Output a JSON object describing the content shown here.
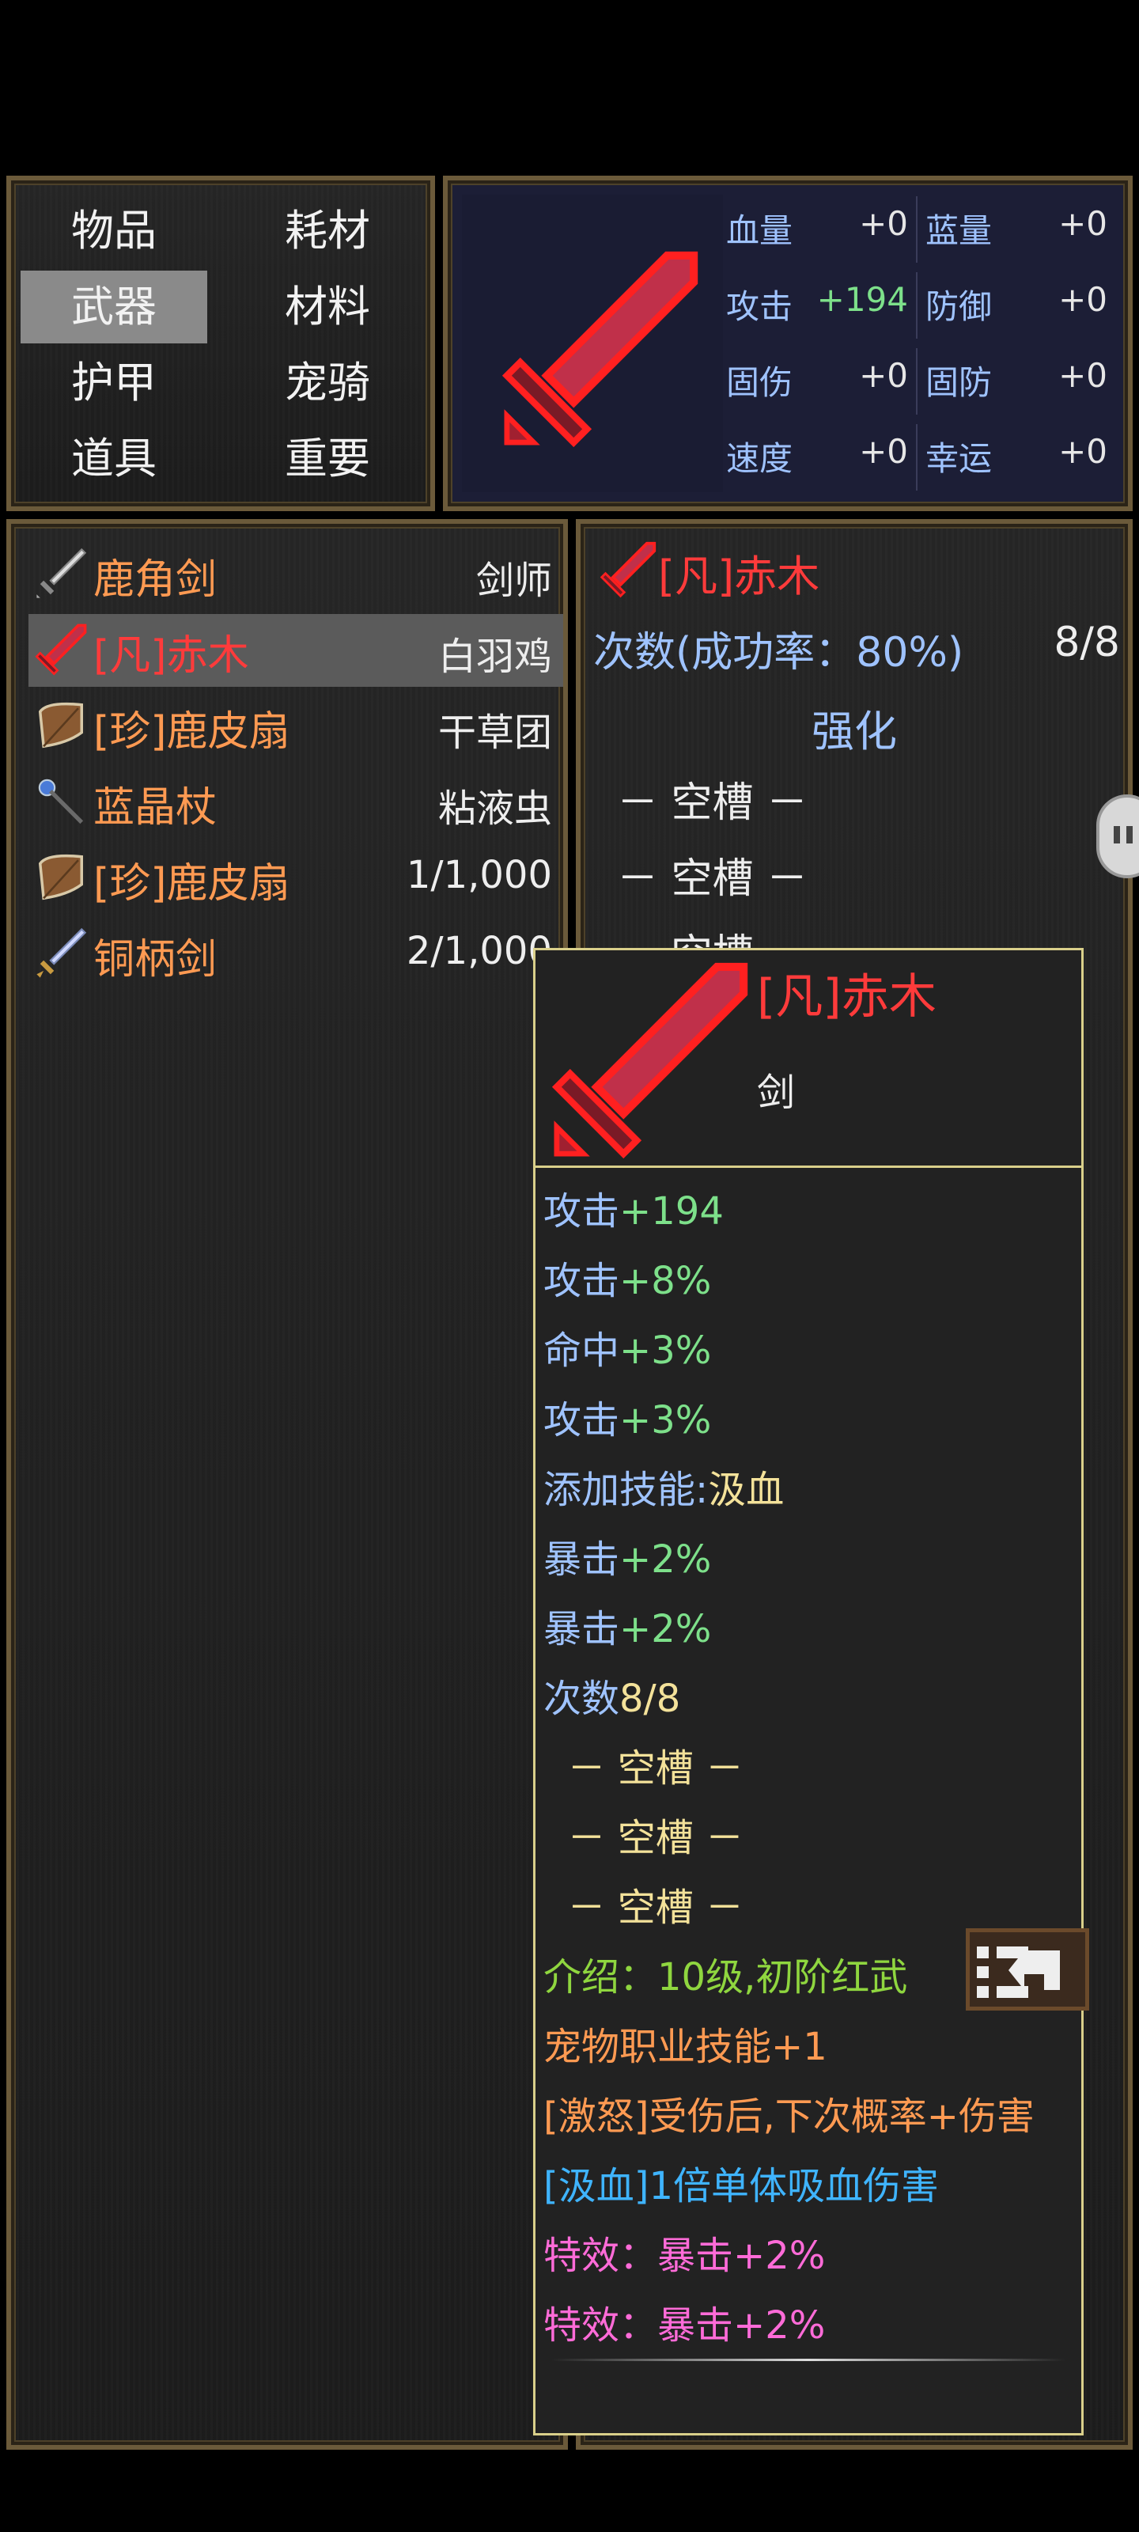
{
  "categories": [
    {
      "label": "物品",
      "selected": false
    },
    {
      "label": "耗材",
      "selected": false
    },
    {
      "label": "武器",
      "selected": true
    },
    {
      "label": "材料",
      "selected": false
    },
    {
      "label": "护甲",
      "selected": false
    },
    {
      "label": "宠骑",
      "selected": false
    },
    {
      "label": "道具",
      "selected": false
    },
    {
      "label": "重要",
      "selected": false
    }
  ],
  "stats": [
    {
      "label": "血量",
      "value": "+0"
    },
    {
      "label": "蓝量",
      "value": "+0"
    },
    {
      "label": "攻击",
      "value": "+194",
      "highlight": true
    },
    {
      "label": "防御",
      "value": "+0"
    },
    {
      "label": "固伤",
      "value": "+0"
    },
    {
      "label": "固防",
      "value": "+0"
    },
    {
      "label": "速度",
      "value": "+0"
    },
    {
      "label": "幸运",
      "value": "+0"
    }
  ],
  "items": [
    {
      "name": "鹿角剑",
      "right": "剑师",
      "icon": "short-sword-icon",
      "color": "#ff9a52",
      "selected": false
    },
    {
      "name": "[凡]赤木",
      "right": "白羽鸡",
      "icon": "red-sword-icon",
      "color": "#ff3b3b",
      "selected": true
    },
    {
      "name": "[珍]鹿皮扇",
      "right": "干草团",
      "icon": "leather-fan-icon",
      "color": "#ff9a52",
      "selected": false
    },
    {
      "name": "蓝晶杖",
      "right": "粘液虫",
      "icon": "crystal-staff-icon",
      "color": "#ff9a52",
      "selected": false
    },
    {
      "name": "[珍]鹿皮扇",
      "right": "1/1,000",
      "icon": "leather-fan-icon",
      "color": "#ff9a52",
      "selected": false
    },
    {
      "name": "铜柄剑",
      "right": "2/1,000",
      "icon": "bronze-sword-icon",
      "color": "#ff9a52",
      "selected": false
    }
  ],
  "detail": {
    "name": "[凡]赤木",
    "attempts_label": "次数(成功率：80%)",
    "attempts_value": "8/8",
    "enhance_label": "强化",
    "slots": [
      "－ 空槽 －",
      "－ 空槽 －",
      "－ 空槽 －"
    ]
  },
  "tooltip": {
    "name": "[凡]赤木",
    "type": "剑",
    "lines": [
      {
        "k": "攻击",
        "v": "+194",
        "kc": "blue",
        "vc": "green"
      },
      {
        "k": "攻击",
        "v": "+8%",
        "kc": "blue",
        "vc": "green"
      },
      {
        "k": "命中",
        "v": "+3%",
        "kc": "blue",
        "vc": "green"
      },
      {
        "k": "攻击",
        "v": "+3%",
        "kc": "blue",
        "vc": "green"
      },
      {
        "k": "添加技能:",
        "v": "汲血",
        "kc": "blue",
        "vc": "yellow"
      },
      {
        "k": "暴击",
        "v": "+2%",
        "kc": "blue",
        "vc": "green"
      },
      {
        "k": "暴击",
        "v": "+2%",
        "kc": "blue",
        "vc": "green"
      },
      {
        "k": "次数",
        "v": "8/8",
        "kc": "blue",
        "vc": "yellow"
      },
      {
        "k": "  － 空槽 －",
        "v": "",
        "kc": "yellow",
        "vc": "yellow"
      },
      {
        "k": "  － 空槽 －",
        "v": "",
        "kc": "yellow",
        "vc": "yellow"
      },
      {
        "k": "  － 空槽 －",
        "v": "",
        "kc": "yellow",
        "vc": "yellow"
      },
      {
        "k": "介绍：10级,初阶红武",
        "v": "",
        "kc": "olive",
        "vc": "olive"
      },
      {
        "k": "宠物职业技能+1",
        "v": "",
        "kc": "orange",
        "vc": "orange"
      },
      {
        "k": "[激怒]受伤后,下次概率+伤害",
        "v": "",
        "kc": "orange",
        "vc": "orange"
      },
      {
        "k": "[汲血]1倍单体吸血伤害",
        "v": "",
        "kc": "cyan",
        "vc": "cyan"
      },
      {
        "k": "特效：暴击+2%",
        "v": "",
        "kc": "pink",
        "vc": "pink"
      },
      {
        "k": "特效：暴击+2%",
        "v": "",
        "kc": "pink",
        "vc": "pink"
      }
    ]
  }
}
